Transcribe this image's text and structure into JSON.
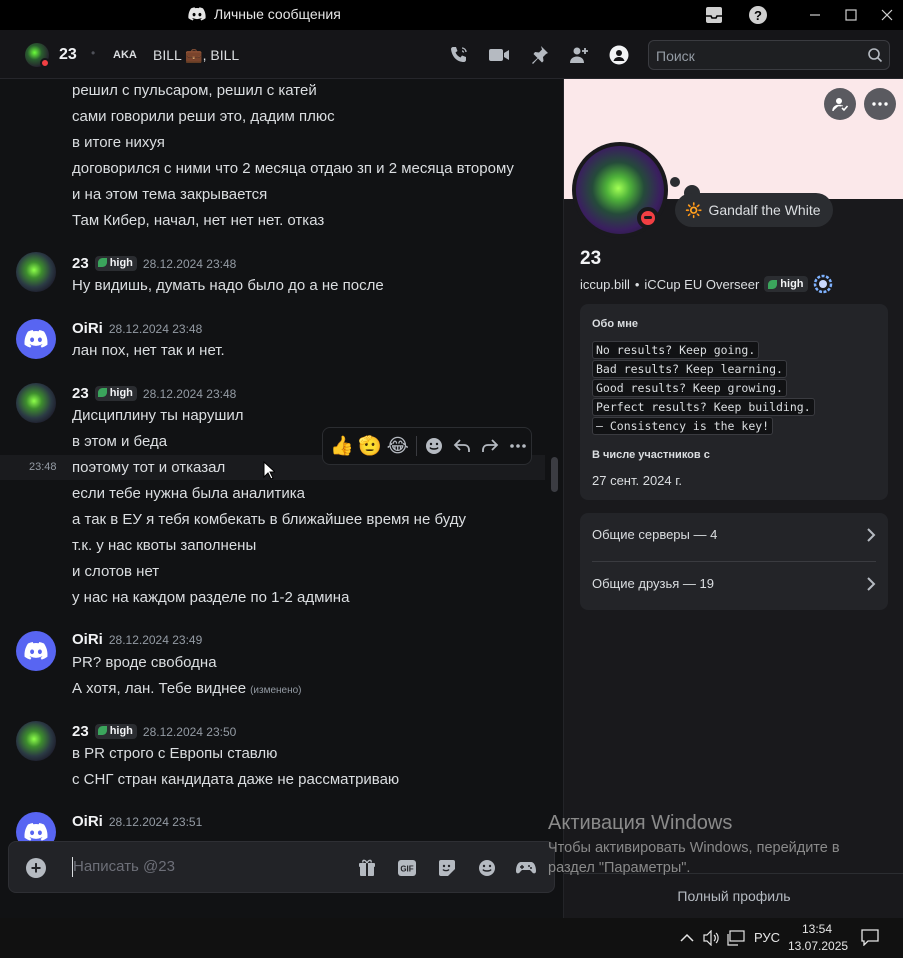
{
  "titlebar": {
    "title": "Личные сообщения"
  },
  "header": {
    "name": "23",
    "aka_label": "AKA",
    "aka_value": "BILL 💼, BILL",
    "search_placeholder": "Поиск"
  },
  "messages": {
    "cont_lines": [
      "решил с пульсаром, решил с катей",
      "сами говорили реши это, дадим плюс",
      "в итоге нихуя",
      "договорился с ними что 2 месяца отдаю зп и 2 месяца второму",
      "и на этом тема закрывается",
      "Там Кибер, начал, нет нет нет. отказ"
    ],
    "g1": {
      "user": "23",
      "tag": "high",
      "ts": "28.12.2024 23:48",
      "lines": [
        "Ну видишь, думать надо было до а не после"
      ]
    },
    "g2": {
      "user": "OiRi",
      "ts": "28.12.2024 23:48",
      "lines": [
        "лан пох, нет так и нет."
      ]
    },
    "g3": {
      "user": "23",
      "tag": "high",
      "ts": "28.12.2024 23:48",
      "lines": [
        "Дисциплину ты нарушил",
        "в этом и беда",
        "поэтому тот и отказал",
        "если тебе нужна была аналитика",
        "а так в ЕУ я тебя комбекать в ближайшее время не буду",
        "т.к. у нас квоты заполнены",
        "и слотов нет",
        "у нас на каждом разделе по 1-2 админа"
      ],
      "hover_ts": "23:48"
    },
    "g4": {
      "user": "OiRi",
      "ts": "28.12.2024 23:49",
      "lines": [
        "PR? вроде свободна",
        "А хотя, лан. Тебе виднее"
      ],
      "edited": "(изменено)"
    },
    "g5": {
      "user": "23",
      "tag": "high",
      "ts": "28.12.2024 23:50",
      "lines": [
        "в PR строго с Европы ставлю",
        "с СНГ стран кандидата даже не рассматриваю"
      ]
    },
    "g6": {
      "user": "OiRi",
      "ts": "28.12.2024 23:51"
    }
  },
  "reactbar": {
    "emojis": [
      "👍",
      "🫡",
      "😂"
    ]
  },
  "composer": {
    "placeholder": "Написать @23",
    "gif_label": "GIF"
  },
  "profile": {
    "status_emoji": "🔆",
    "status_text": "Gandalf the White",
    "display_name": "23",
    "username": "iccup.bill",
    "separator": "•",
    "pronouns": "iCCup EU Overseer",
    "tag": "high",
    "about_title": "Обо мне",
    "about_lines": [
      "No results? Keep going.",
      "Bad results? Keep learning.",
      "Good results? Keep growing.",
      "Perfect results? Keep building.",
      "— Consistency is the key!"
    ],
    "member_since_title": "В числе участников с",
    "member_since": "27 сент. 2024 г.",
    "mutual_servers": "Общие серверы — 4",
    "mutual_friends": "Общие друзья — 19",
    "full_profile": "Полный профиль"
  },
  "activation": {
    "title": "Активация Windows",
    "line1": "Чтобы активировать Windows, перейдите в",
    "line2": "раздел \"Параметры\"."
  },
  "taskbar": {
    "lang": "РУС",
    "time": "13:54",
    "date": "13.07.2025"
  },
  "colors": {
    "accent": "#5865f2",
    "dnd": "#f23f43",
    "tag_leaf": "#3ba55c",
    "banner": "#fbe8ea"
  }
}
